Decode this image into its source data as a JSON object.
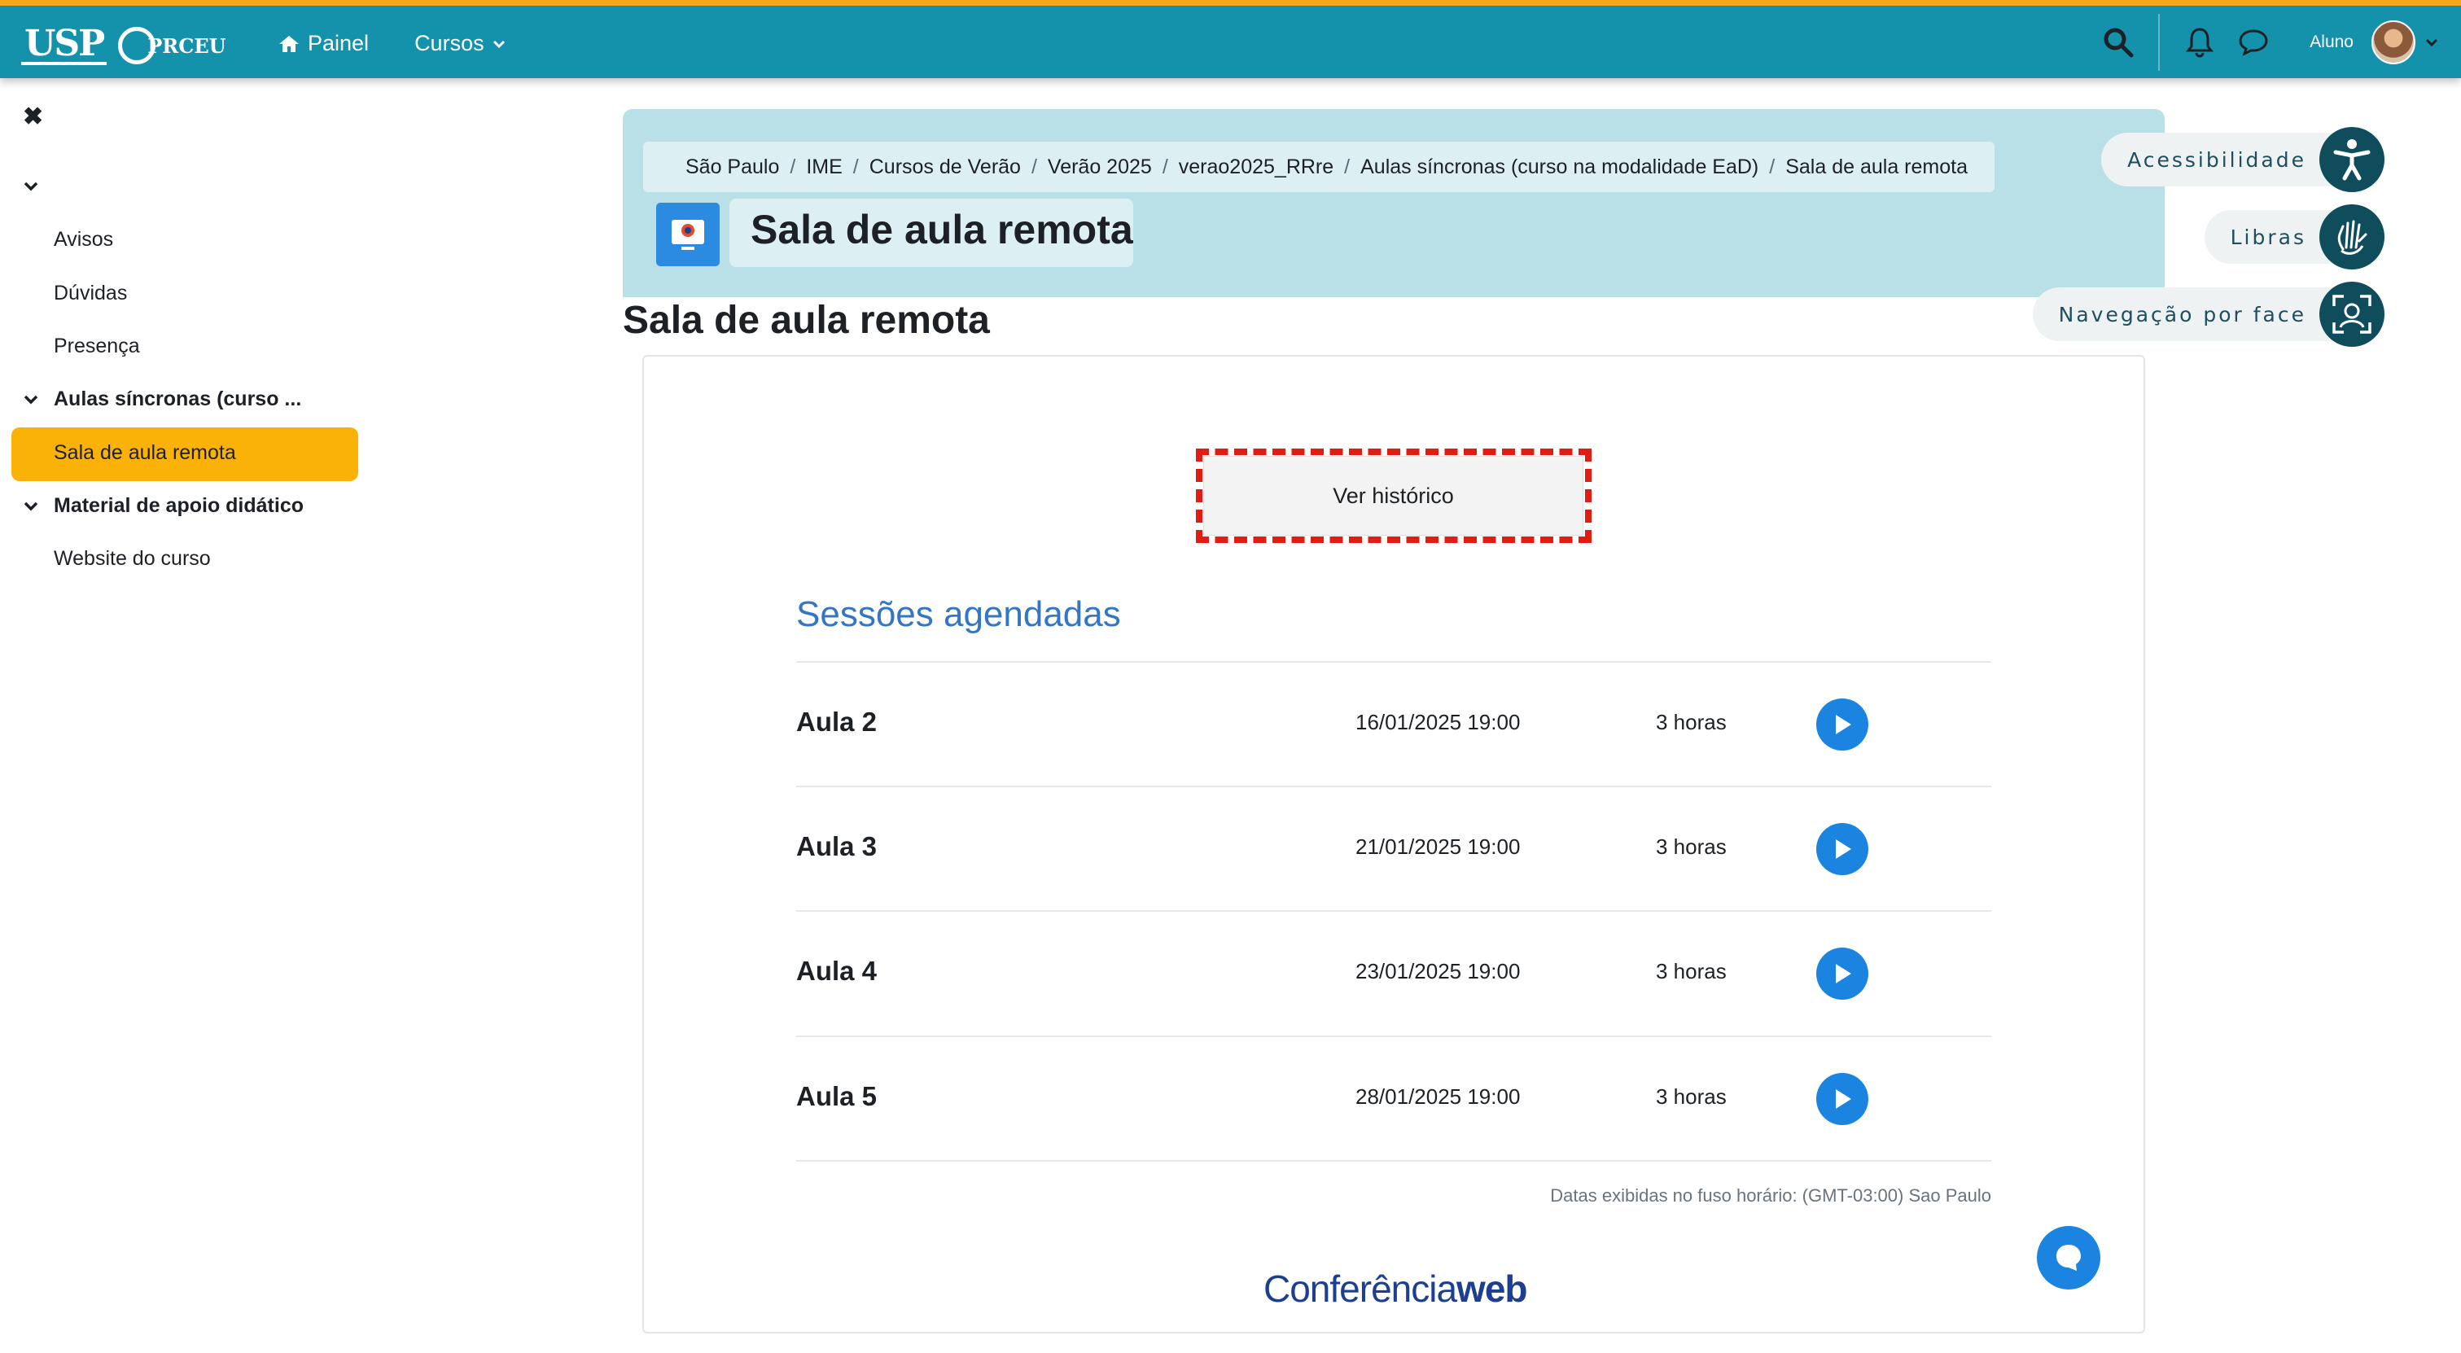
{
  "topbar": {
    "logo_usp": "USP",
    "logo_prceu": "PRCEU",
    "nav": [
      {
        "label": "Painel",
        "icon": "home-icon"
      },
      {
        "label": "Cursos",
        "icon": "chevron-down-icon"
      }
    ],
    "user_label": "Aluno",
    "accent_color": "#1592ab",
    "top_border_color": "#f3a81c"
  },
  "sidebar": {
    "items": [
      {
        "label": "Avisos"
      },
      {
        "label": "Dúvidas"
      },
      {
        "label": "Presença"
      },
      {
        "label": "Aulas síncronas (curso ..."
      },
      {
        "label": "Sala de aula remota"
      },
      {
        "label": "Material de apoio didático"
      },
      {
        "label": "Website do curso"
      }
    ],
    "active_color": "#fbb208"
  },
  "breadcrumb": [
    "São Paulo",
    "IME",
    "Cursos de Verão",
    "Verão 2025",
    "verao2025_RRre",
    "Aulas síncronas (curso na modalidade EaD)",
    "Sala de aula remota"
  ],
  "header": {
    "title": "Sala de aula remota"
  },
  "page_title": "Sala de aula remota",
  "main": {
    "history_button": "Ver histórico",
    "sessions_title": "Sessões agendadas",
    "sessions": [
      {
        "name": "Aula 2",
        "date": "16/01/2025 19:00",
        "duration": "3 horas"
      },
      {
        "name": "Aula 3",
        "date": "21/01/2025 19:00",
        "duration": "3 horas"
      },
      {
        "name": "Aula 4",
        "date": "23/01/2025 19:00",
        "duration": "3 horas"
      },
      {
        "name": "Aula 5",
        "date": "28/01/2025 19:00",
        "duration": "3 horas"
      }
    ],
    "timezone_note": "Datas exibidas no fuso horário: (GMT-03:00) Sao Paulo",
    "brand_part1": "Conferência",
    "brand_part2": "web"
  },
  "accessibility": [
    {
      "label": "Acessibilidade",
      "icon": "accessibility-icon"
    },
    {
      "label": "Libras",
      "icon": "sign-language-hand-icon"
    },
    {
      "label": "Navegação por face",
      "icon": "face-scan-icon"
    }
  ]
}
